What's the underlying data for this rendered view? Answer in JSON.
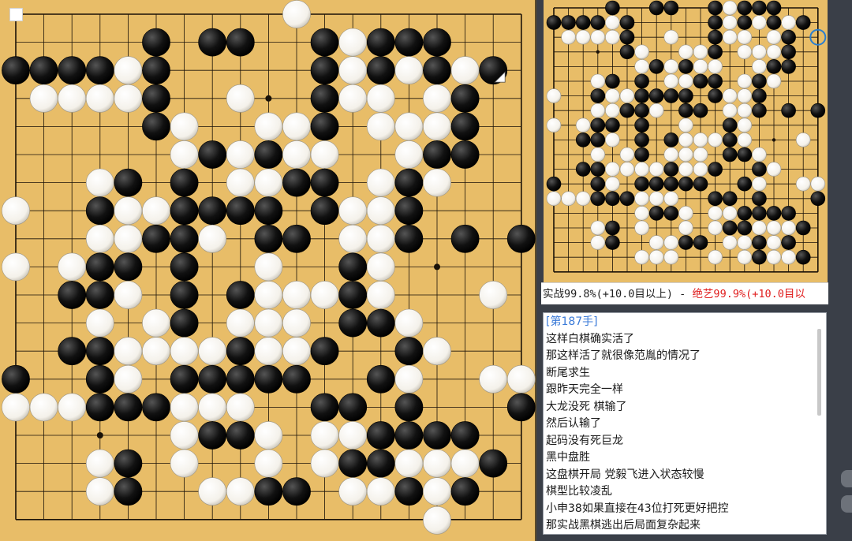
{
  "boards": {
    "main": {
      "last_move": [
        2,
        17
      ],
      "grid": [
        "..........W........",
        ".....B.BB..BWBBB...",
        "BBBBWB.....BWBWBWB.",
        ".WWWWB..W..BWW.WB..",
        ".....BW..WWB.WWWB..",
        "......WBWBWW..WBB..",
        "...WB.B.WWBB.WBW...",
        "W..BWWBBBB.BWWB....",
        "...WWBBW.BB.WWB.B.B",
        "W.WBB.B..W..BW.....",
        "..BBW.B.BWWWBW...W.",
        "...W.WB.WWW.BBW....",
        "..BBWWWWBWWB..BW...",
        "B..BW.BBBBB..BW..WW",
        "WWWBBBWWW..BB.B...B",
        "......WBBW.WWBBBB..",
        "...WB.W..W.WBBWWWB.",
        "...WB..WWBB.WWBWB..",
        "..................."
      ],
      "extra_top_stone": "W",
      "extra_bottom_stone": "W"
    },
    "mini": {
      "highlight": [
        2,
        18
      ],
      "grid": [
        "....B..BB..BWBBB...",
        "BBBBWB.....BWBWBWB.",
        ".WWWWB..W..BWW.WB..",
        ".....BW..WWB.WWWB..",
        "......WBWBWW..WBB..",
        "...WB.B.WWBB.WBW...",
        "W..BWWBBBB.BWWB....",
        "...WWBBW.BB.WWB.B.B",
        "W.WBB.B..W..BW.....",
        "..BBW.B.BWWWBW...W.",
        "...W.WB.WWW.BBW....",
        "..BBWWWWBWWB..BW...",
        "B..BW.BBBBB..BW..WW",
        "WWWBBBWWW..BB.B...B",
        "......WBBW.WWBBBB..",
        "...WB.W..W.WBBWWWB.",
        "...WB..WWBB.WWBWB..",
        "......WWW..W.WBWWB.",
        "..................."
      ]
    }
  },
  "colors": {
    "board": "#e8bd68",
    "line": "#1a1208",
    "black_stone": "#111111",
    "white_stone": "#f4f1ea",
    "highlight_ring": "#2a7fd0"
  },
  "winrate": {
    "black_text": "实战99.8%(+10.0目以上)",
    "separator": " - ",
    "ai_text": "绝艺99.9%(+10.0目以"
  },
  "commentary": {
    "move_label": "[第187手]",
    "lines": [
      "这样白棋确实活了",
      "那这样活了就很像范胤的情况了",
      "断尾求生",
      "跟昨天完全一样",
      "大龙没死 棋输了",
      "然后认输了",
      "起码没有死巨龙",
      "黑中盘胜",
      "这盘棋开局 党毅飞进入状态较慢",
      "棋型比较凌乱",
      "小申38如果直接在43位打死更好把控",
      "那实战黑棋逃出后局面复杂起来"
    ]
  },
  "icons": {
    "corner_toggle": "square-icon",
    "last_move_marker": "triangle-marker-icon"
  }
}
